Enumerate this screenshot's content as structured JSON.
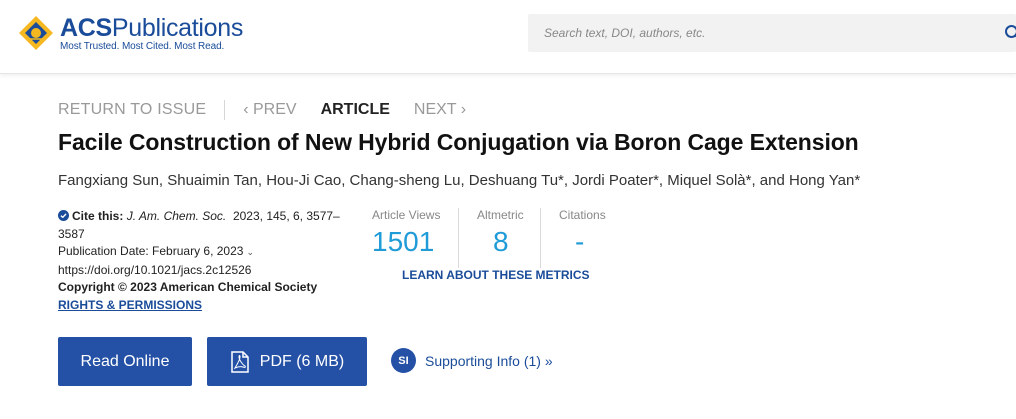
{
  "header": {
    "logo": {
      "brand_prefix": "ACS",
      "brand_suffix": "Publications",
      "tagline": "Most Trusted. Most Cited. Most Read."
    },
    "search": {
      "placeholder": "Search text, DOI, authors, etc.",
      "value": ""
    }
  },
  "nav": {
    "return_label": "RETURN TO ISSUE",
    "prev_label": "‹ PREV",
    "current_label": "ARTICLE",
    "next_label": "NEXT ›"
  },
  "article": {
    "title": "Facile Construction of New Hybrid Conjugation via Boron Cage Extension",
    "authors": "Fangxiang Sun, Shuaimin Tan, Hou-Ji Cao, Chang-sheng Lu, Deshuang Tu*, Jordi Poater*, Miquel Solà*, and Hong Yan*"
  },
  "citation": {
    "cite_label": "Cite this:",
    "journal": "J. Am. Chem. Soc.",
    "details_line1": "2023, 145, 6, 3577–",
    "details_line2": "3587",
    "pub_date": "Publication Date: February 6, 2023",
    "doi": "https://doi.org/10.1021/jacs.2c12526",
    "copyright": "Copyright © 2023 American Chemical Society",
    "rights_link": "RIGHTS & PERMISSIONS"
  },
  "metrics": {
    "views_label": "Article Views",
    "views_value": "1501",
    "altmetric_label": "Altmetric",
    "altmetric_value": "8",
    "citations_label": "Citations",
    "citations_value": "-",
    "learn_link": "LEARN ABOUT THESE METRICS"
  },
  "actions": {
    "read_online": "Read Online",
    "pdf": "PDF (6 MB)",
    "si_badge": "SI",
    "supporting_info": "Supporting Info (1) »"
  },
  "colors": {
    "brand_blue": "#1a4c9a",
    "button_blue": "#2451a6",
    "metric_blue": "#1f9bd7",
    "logo_gold": "#f5b820"
  },
  "icons": [
    "acs-logo-icon",
    "search-icon",
    "check-badge-icon",
    "chevron-down-icon",
    "pdf-icon"
  ]
}
